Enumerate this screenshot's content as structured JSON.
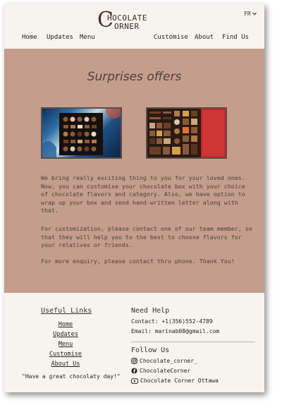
{
  "brand": {
    "logo_line1": "HOCOLATE",
    "logo_line2": "ORNER",
    "logo_initial": "C"
  },
  "language": {
    "selected": "FR",
    "icon": "chevron-down-icon"
  },
  "nav_left": [
    "Home",
    "Updates",
    "Menu"
  ],
  "nav_right": [
    "Customise",
    "About",
    "Find Us"
  ],
  "main": {
    "title": "Surprises offers",
    "photos": [
      "chocolate-box-photo-assorted",
      "chocolate-box-photo-red-lid"
    ],
    "paragraphs": [
      "We bring really exciting thing to you for your loved ones. Now, you can customise your chocolate box with your choice of chocolate flavors and category. Also, we have option to wrap up your box and send hand-written letter along with that.",
      "For customization, please contact one of our team member, so that they will help you to the best to choose flavors for your relatives or friends.",
      "For more enquiry, please contact thru phone. Thank You!"
    ]
  },
  "footer": {
    "useful_links_title": "Useful Links",
    "links": [
      "Home",
      "Updates",
      "Menu",
      "Customise",
      "About Us"
    ],
    "quote": "\"Have a great chocolaty day!\"",
    "need_help_title": "Need Help",
    "contact": "Contact: +1(356)552-4789",
    "email": "Email: marinab08@gmail.com",
    "follow_title": "Follow Us",
    "social": [
      {
        "icon": "instagram-icon",
        "label": "Chocolate_corner_"
      },
      {
        "icon": "facebook-icon",
        "label": "ChocolateCorner"
      },
      {
        "icon": "youtube-icon",
        "label": "Chocolate Corner Ottawa"
      }
    ]
  },
  "colors": {
    "main_bg": "#c49d8d",
    "page_bg": "#f7f4ef",
    "text": "#4d403b",
    "accent_red": "#c62828"
  }
}
